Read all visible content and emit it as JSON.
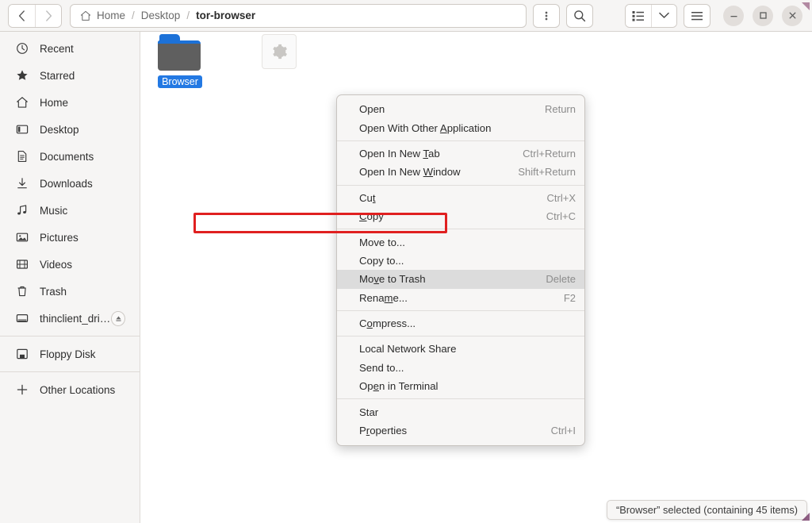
{
  "header": {
    "nav": {
      "back_label": "Back",
      "forward_label": "Forward"
    },
    "breadcrumb": [
      {
        "label": "Home",
        "icon": "home-icon",
        "current": false
      },
      {
        "label": "Desktop",
        "icon": "",
        "current": false
      },
      {
        "label": "tor-browser",
        "icon": "",
        "current": true
      }
    ],
    "separator": "/",
    "kebab_label": "⋮",
    "search_label": "search-icon",
    "view_list_label": "list-view-icon",
    "view_dropdown_label": "chevron-down-icon",
    "hamburger_label": "main-menu-icon",
    "window_controls": {
      "minimize": "–",
      "maximize": "□",
      "close": "✕"
    }
  },
  "sidebar": {
    "items": [
      {
        "label": "Recent",
        "icon": "clock-icon"
      },
      {
        "label": "Starred",
        "icon": "star-icon"
      },
      {
        "label": "Home",
        "icon": "home-icon"
      },
      {
        "label": "Desktop",
        "icon": "desktop-icon"
      },
      {
        "label": "Documents",
        "icon": "document-icon"
      },
      {
        "label": "Downloads",
        "icon": "download-icon"
      },
      {
        "label": "Music",
        "icon": "music-note-icon"
      },
      {
        "label": "Pictures",
        "icon": "picture-icon"
      },
      {
        "label": "Videos",
        "icon": "video-icon"
      },
      {
        "label": "Trash",
        "icon": "trash-icon"
      },
      {
        "label": "thinclient_drives",
        "icon": "drive-icon",
        "eject": true
      },
      {
        "label": "Floppy Disk",
        "icon": "floppy-icon"
      },
      {
        "label": "Other Locations",
        "icon": "plus-icon"
      }
    ]
  },
  "content": {
    "files": [
      {
        "name": "Browser",
        "type": "folder",
        "selected": true
      },
      {
        "name": "",
        "type": "gear-file",
        "selected": false
      }
    ]
  },
  "context_menu": {
    "items": [
      {
        "label": "Open",
        "accel": "Return",
        "mnemonic": "",
        "highlight": false
      },
      {
        "label": "Open With Other Application",
        "accel": "",
        "mnemonic": "A",
        "highlight": false
      },
      {
        "sep": true
      },
      {
        "label": "Open In New Tab",
        "accel": "Ctrl+Return",
        "mnemonic": "T",
        "highlight": false
      },
      {
        "label": "Open In New Window",
        "accel": "Shift+Return",
        "mnemonic": "W",
        "highlight": false
      },
      {
        "sep": true
      },
      {
        "label": "Cut",
        "accel": "Ctrl+X",
        "mnemonic": "t",
        "highlight": false
      },
      {
        "label": "Copy",
        "accel": "Ctrl+C",
        "mnemonic": "C",
        "highlight": false
      },
      {
        "sep": true
      },
      {
        "label": "Move to...",
        "accel": "",
        "mnemonic": "",
        "highlight": false
      },
      {
        "label": "Copy to...",
        "accel": "",
        "mnemonic": "",
        "highlight": false
      },
      {
        "label": "Move to Trash",
        "accel": "Delete",
        "mnemonic": "v",
        "highlight": true
      },
      {
        "label": "Rename...",
        "accel": "F2",
        "mnemonic": "m",
        "highlight": false
      },
      {
        "sep": true
      },
      {
        "label": "Compress...",
        "accel": "",
        "mnemonic": "o",
        "highlight": false
      },
      {
        "sep": true
      },
      {
        "label": "Local Network Share",
        "accel": "",
        "mnemonic": "",
        "highlight": false
      },
      {
        "label": "Send to...",
        "accel": "",
        "mnemonic": "",
        "highlight": false
      },
      {
        "label": "Open in Terminal",
        "accel": "",
        "mnemonic": "e",
        "highlight": false
      },
      {
        "sep": true
      },
      {
        "label": "Star",
        "accel": "",
        "mnemonic": "",
        "highlight": false
      },
      {
        "label": "Properties",
        "accel": "Ctrl+I",
        "mnemonic": "r",
        "highlight": false
      }
    ]
  },
  "annotation": {
    "target": "Move to Trash",
    "color": "#e02020"
  },
  "status": {
    "text": "“Browser” selected  (containing 45 items)"
  },
  "colors": {
    "accent": "#2379e3",
    "headerbar": "#f6f5f4",
    "sidebar": "#f6f5f4",
    "menu_highlight": "#dcdcdc",
    "annotation_red": "#e02020"
  }
}
